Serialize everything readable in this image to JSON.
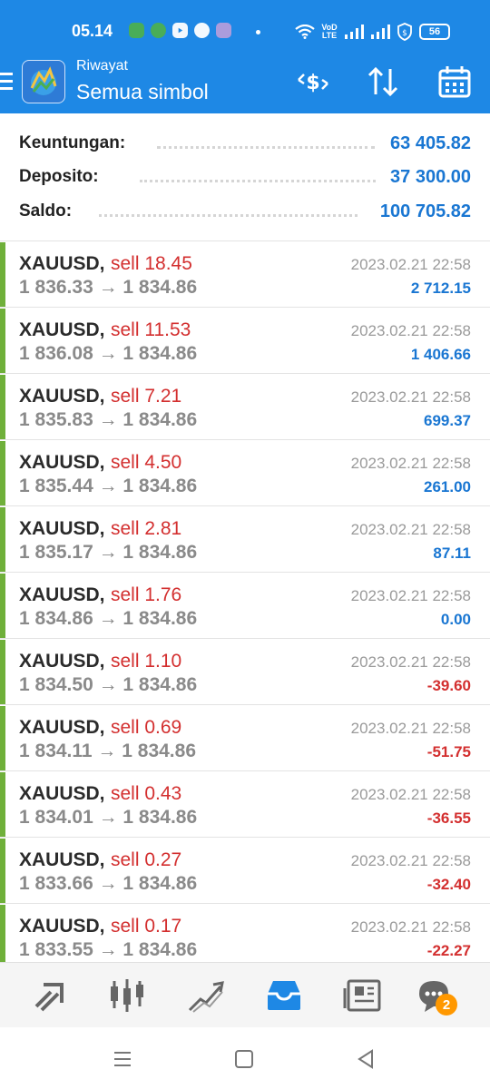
{
  "status_bar": {
    "time": "05.14",
    "network_label": "VoD LTE",
    "battery": "56"
  },
  "header": {
    "subtitle": "Riwayat",
    "title": "Semua simbol"
  },
  "summary": {
    "profit_label": "Keuntungan:",
    "profit_value": "63 405.82",
    "deposit_label": "Deposito:",
    "deposit_value": "37 300.00",
    "balance_label": "Saldo:",
    "balance_value": "100 705.82"
  },
  "trades": [
    {
      "symbol": "XAUUSD,",
      "side": "sell 18.45",
      "prices": "1 836.33 → 1 834.86",
      "time": "2023.02.21 22:58",
      "profit": "2 712.15",
      "sign": "pos"
    },
    {
      "symbol": "XAUUSD,",
      "side": "sell 11.53",
      "prices": "1 836.08 → 1 834.86",
      "time": "2023.02.21 22:58",
      "profit": "1 406.66",
      "sign": "pos"
    },
    {
      "symbol": "XAUUSD,",
      "side": "sell 7.21",
      "prices": "1 835.83 → 1 834.86",
      "time": "2023.02.21 22:58",
      "profit": "699.37",
      "sign": "pos"
    },
    {
      "symbol": "XAUUSD,",
      "side": "sell 4.50",
      "prices": "1 835.44 → 1 834.86",
      "time": "2023.02.21 22:58",
      "profit": "261.00",
      "sign": "pos"
    },
    {
      "symbol": "XAUUSD,",
      "side": "sell 2.81",
      "prices": "1 835.17 → 1 834.86",
      "time": "2023.02.21 22:58",
      "profit": "87.11",
      "sign": "pos"
    },
    {
      "symbol": "XAUUSD,",
      "side": "sell 1.76",
      "prices": "1 834.86 → 1 834.86",
      "time": "2023.02.21 22:58",
      "profit": "0.00",
      "sign": "pos"
    },
    {
      "symbol": "XAUUSD,",
      "side": "sell 1.10",
      "prices": "1 834.50 → 1 834.86",
      "time": "2023.02.21 22:58",
      "profit": "-39.60",
      "sign": "neg"
    },
    {
      "symbol": "XAUUSD,",
      "side": "sell 0.69",
      "prices": "1 834.11 → 1 834.86",
      "time": "2023.02.21 22:58",
      "profit": "-51.75",
      "sign": "neg"
    },
    {
      "symbol": "XAUUSD,",
      "side": "sell 0.43",
      "prices": "1 834.01 → 1 834.86",
      "time": "2023.02.21 22:58",
      "profit": "-36.55",
      "sign": "neg"
    },
    {
      "symbol": "XAUUSD,",
      "side": "sell 0.27",
      "prices": "1 833.66 → 1 834.86",
      "time": "2023.02.21 22:58",
      "profit": "-32.40",
      "sign": "neg"
    },
    {
      "symbol": "XAUUSD,",
      "side": "sell 0.17",
      "prices": "1 833.55 → 1 834.86",
      "time": "2023.02.21 22:58",
      "profit": "-22.27",
      "sign": "neg"
    }
  ],
  "tabbar": {
    "tabs": [
      "quotes-icon",
      "chart-icon",
      "trade-icon",
      "history-icon",
      "news-icon",
      "chat-icon"
    ],
    "active": "history-icon",
    "chat_badge": "2"
  },
  "colors": {
    "header_blue": "#1e88e5",
    "positive": "#1976d2",
    "negative": "#d32f2f",
    "row_accent": "#6fb03a",
    "badge": "#ff9800"
  }
}
